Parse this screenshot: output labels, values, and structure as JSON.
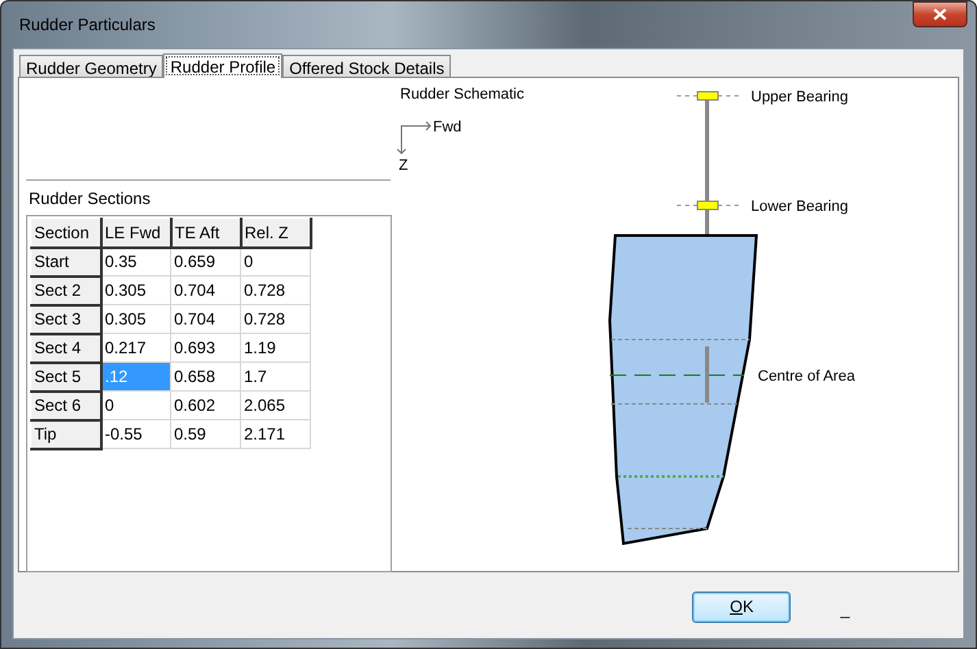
{
  "window": {
    "title": "Rudder Particulars"
  },
  "tabs": [
    {
      "label": "Rudder Geometry",
      "selected": false
    },
    {
      "label": "Rudder Profile",
      "selected": true
    },
    {
      "label": "Offered Stock Details",
      "selected": false
    }
  ],
  "schematic": {
    "title": "Rudder Schematic",
    "axis_x": "Fwd",
    "axis_z": "Z",
    "upper_bearing": "Upper Bearing",
    "lower_bearing": "Lower Bearing",
    "centre_of_area": "Centre of Area"
  },
  "sections": {
    "title": "Rudder Sections",
    "columns": [
      "Section",
      "LE Fwd",
      "TE Aft",
      "Rel. Z"
    ],
    "rows": [
      {
        "cells": [
          {
            "text": "Start",
            "selected": false
          },
          {
            "text": "0.35",
            "selected": false
          },
          {
            "text": "0.659",
            "selected": false
          },
          {
            "text": "0",
            "selected": false
          }
        ]
      },
      {
        "cells": [
          {
            "text": "Sect 2",
            "selected": false
          },
          {
            "text": "0.305",
            "selected": false
          },
          {
            "text": "0.704",
            "selected": false
          },
          {
            "text": "0.728",
            "selected": false
          }
        ]
      },
      {
        "cells": [
          {
            "text": "Sect 3",
            "selected": false
          },
          {
            "text": "0.305",
            "selected": false
          },
          {
            "text": "0.704",
            "selected": false
          },
          {
            "text": "0.728",
            "selected": false
          }
        ]
      },
      {
        "cells": [
          {
            "text": "Sect 4",
            "selected": false
          },
          {
            "text": "0.217",
            "selected": false
          },
          {
            "text": "0.693",
            "selected": false
          },
          {
            "text": "1.19",
            "selected": false
          }
        ]
      },
      {
        "cells": [
          {
            "text": "Sect 5",
            "selected": false
          },
          {
            "text": ".12",
            "selected": true
          },
          {
            "text": "0.658",
            "selected": false
          },
          {
            "text": "1.7",
            "selected": false
          }
        ]
      },
      {
        "cells": [
          {
            "text": "Sect 6",
            "selected": false
          },
          {
            "text": "0",
            "selected": false
          },
          {
            "text": "0.602",
            "selected": false
          },
          {
            "text": "2.065",
            "selected": false
          }
        ]
      },
      {
        "cells": [
          {
            "text": "Tip",
            "selected": false
          },
          {
            "text": "-0.55",
            "selected": false
          },
          {
            "text": "0.59",
            "selected": false
          },
          {
            "text": "2.171",
            "selected": false
          }
        ]
      }
    ]
  },
  "buttons": [
    {
      "label": "OK"
    }
  ],
  "footer_mark": "_"
}
